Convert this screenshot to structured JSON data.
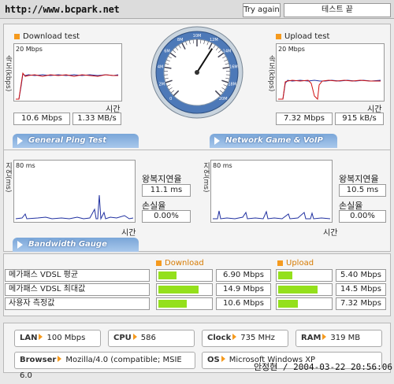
{
  "header": {
    "url": "http://www.bcpark.net",
    "try_again": "Try again",
    "test_status": "테스트 끝"
  },
  "download": {
    "title": "Download test",
    "ylabel": "속도(kbps)",
    "scale": "20 Mbps",
    "xlabel": "시간",
    "mbps": "10.6 Mbps",
    "mbs": "1.33 MB/s"
  },
  "upload": {
    "title": "Upload test",
    "ylabel": "속도(kbps)",
    "scale": "20 Mbps",
    "xlabel": "시간",
    "mbps": "7.32 Mbps",
    "kbs": "915 kB/s"
  },
  "gauge": {
    "ticks": [
      "0",
      "2M",
      "4M",
      "6M",
      "8M",
      "10M",
      "12M",
      "14M",
      "16M",
      "18M",
      "20M"
    ],
    "value_mbps": 12.4
  },
  "sections": {
    "ping": "General Ping Test",
    "game": "Network Game & VoIP Test",
    "bandwidth": "Bandwidth Gauge"
  },
  "ping_left": {
    "ylabel": "지연(ms)",
    "scale": "80 ms",
    "xlabel": "시간",
    "rtt_label": "왕복지연율",
    "rtt": "11.1 ms",
    "loss_label": "손실율",
    "loss": "0.00%"
  },
  "ping_right": {
    "ylabel": "지연(ms)",
    "scale": "80 ms",
    "xlabel": "시간",
    "rtt_label": "왕복지연율",
    "rtt": "10.5 ms",
    "loss_label": "손실율",
    "loss": "0.00%"
  },
  "bandwidth": {
    "download_label": "Download",
    "upload_label": "Upload",
    "rows": [
      {
        "label": "메가패스 VDSL 평균",
        "down": "6.90 Mbps",
        "down_frac": 0.35,
        "up": "5.40 Mbps",
        "up_frac": 0.28
      },
      {
        "label": "메가패스 VDSL 최대값",
        "down": "14.9 Mbps",
        "down_frac": 0.78,
        "up": "14.5 Mbps",
        "up_frac": 0.76
      },
      {
        "label": "사용자 측정값",
        "down": "10.6 Mbps",
        "down_frac": 0.55,
        "up": "7.32 Mbps",
        "up_frac": 0.38
      }
    ]
  },
  "sysinfo": {
    "lan_label": "LAN",
    "lan": "100 Mbps",
    "cpu_label": "CPU",
    "cpu": "586",
    "clock_label": "Clock",
    "clock": "735 MHz",
    "ram_label": "RAM",
    "ram": "319 MB",
    "browser_label": "Browser",
    "browser": "Mozilla/4.0 (compatible; MSIE 6.0",
    "os_label": "OS",
    "os": "Microsoft Windows XP"
  },
  "watermark": "안정현 / 2004-03-22 20:56:06",
  "colors": {
    "accent": "#f59a1e",
    "bar": "#94e01c",
    "tab": "#7aa6d8",
    "trace_red": "#d01010",
    "trace_blue": "#2030a0"
  }
}
